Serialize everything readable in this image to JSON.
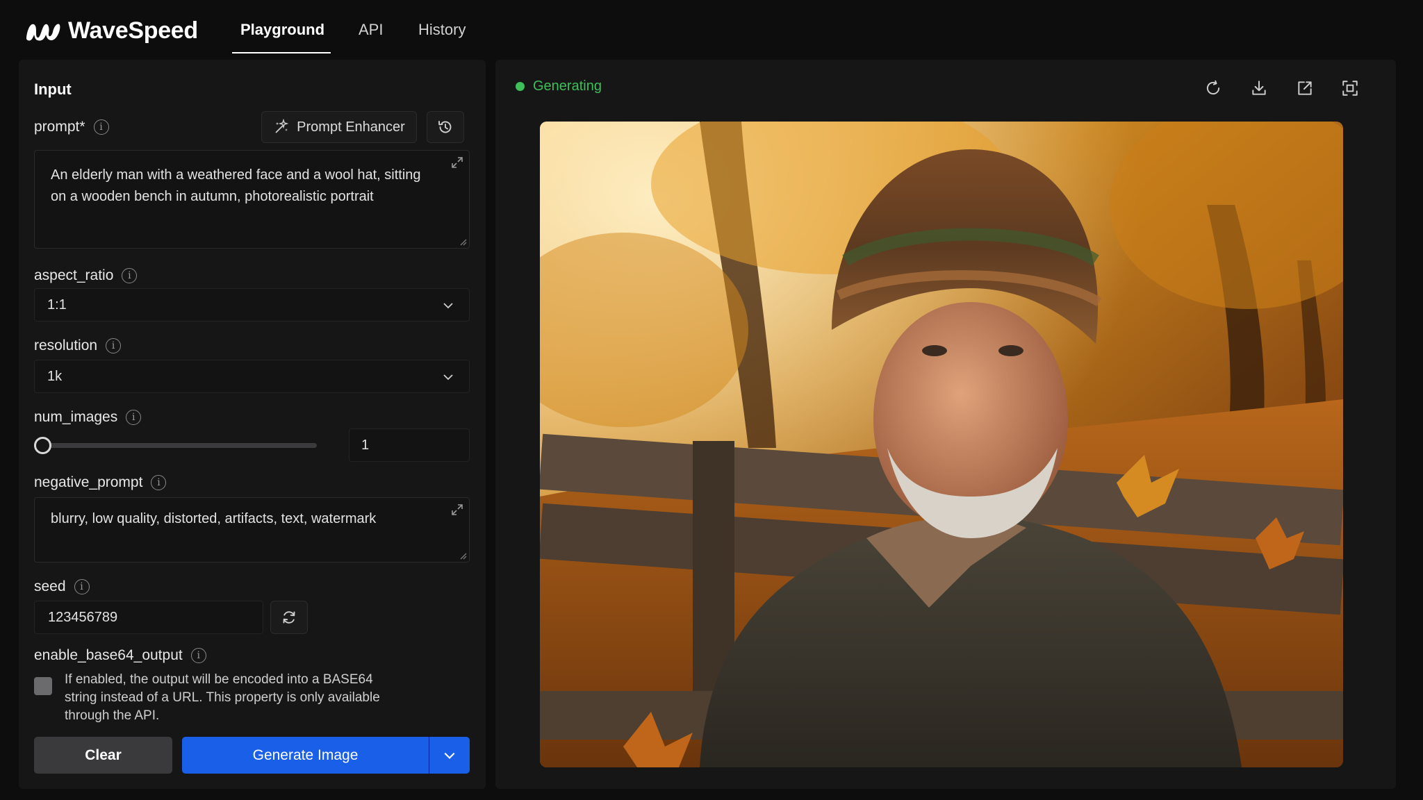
{
  "brand": {
    "name": "WaveSpeed"
  },
  "nav": {
    "tabs": [
      {
        "label": "Playground"
      },
      {
        "label": "API"
      },
      {
        "label": "History"
      }
    ]
  },
  "input_panel": {
    "title": "Input",
    "prompt": {
      "label": "prompt*",
      "enhancer_label": "Prompt Enhancer",
      "value": "An elderly man with a weathered face and a wool hat, sitting on a wooden bench in autumn, photorealistic portrait"
    },
    "aspect_ratio": {
      "label": "aspect_ratio",
      "value": "1:1"
    },
    "resolution": {
      "label": "resolution",
      "value": "1k"
    },
    "num_images": {
      "label": "num_images",
      "value": "1"
    },
    "negative_prompt": {
      "label": "negative_prompt",
      "value": "blurry, low quality, distorted, artifacts, text, watermark"
    },
    "seed": {
      "label": "seed",
      "value": "123456789"
    },
    "enable_base64_output": {
      "label": "enable_base64_output",
      "checked": false,
      "description": "If enabled, the output will be encoded into a BASE64 string instead of a URL. This property is only available through the API."
    },
    "buttons": {
      "clear": "Clear",
      "generate": "Generate Image"
    }
  },
  "output_panel": {
    "status": "Generating",
    "status_color": "#3fbf5a",
    "tools": [
      "refresh-icon",
      "download-icon",
      "open-external-icon",
      "fullscreen-icon"
    ]
  },
  "colors": {
    "accent": "#1a5fe8",
    "panel": "#161617",
    "background": "#0d0d0e"
  }
}
